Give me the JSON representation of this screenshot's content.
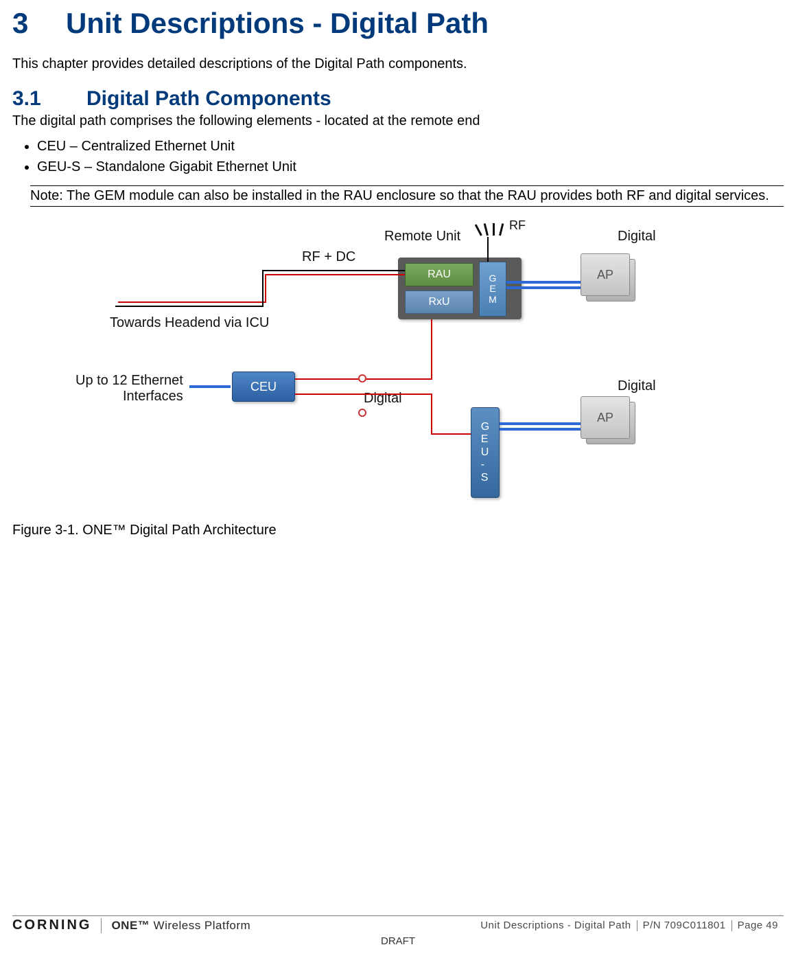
{
  "heading": {
    "num": "3",
    "title": "Unit Descriptions - Digital Path"
  },
  "intro": "This chapter provides detailed descriptions of the Digital Path components.",
  "section": {
    "num": "3.1",
    "title": "Digital Path Components"
  },
  "section_intro": "The digital path comprises the following elements - located at the remote end",
  "bullets": [
    "CEU – Centralized Ethernet Unit",
    "GEU-S – Standalone Gigabit Ethernet Unit"
  ],
  "note": "Note: The GEM module can also be installed in the RAU enclosure so that the RAU provides both RF and digital services.",
  "diagram": {
    "labels": {
      "remote_unit": "Remote Unit",
      "rf": "RF",
      "digital_top": "Digital",
      "rf_dc": "RF + DC",
      "towards_headend": "Towards Headend via ICU",
      "up_to_12": "Up to 12 Ethernet\nInterfaces",
      "digital_mid": "Digital",
      "digital_bottom": "Digital"
    },
    "units": {
      "rau": "RAU",
      "rxu": "RxU",
      "gem": "G\nE\nM",
      "ceu": "CEU",
      "geus": "G\nE\nU\n-\nS",
      "ap": "AP"
    }
  },
  "figure_caption": "Figure 3-1. ONE™ Digital Path Architecture",
  "footer": {
    "logo": "CORNING",
    "platform_bold": "ONE™",
    "platform_rest": " Wireless Platform",
    "chapter": "Unit Descriptions - Digital Path",
    "pn": "P/N 709C011801",
    "page": "Page 49",
    "draft": "DRAFT"
  }
}
